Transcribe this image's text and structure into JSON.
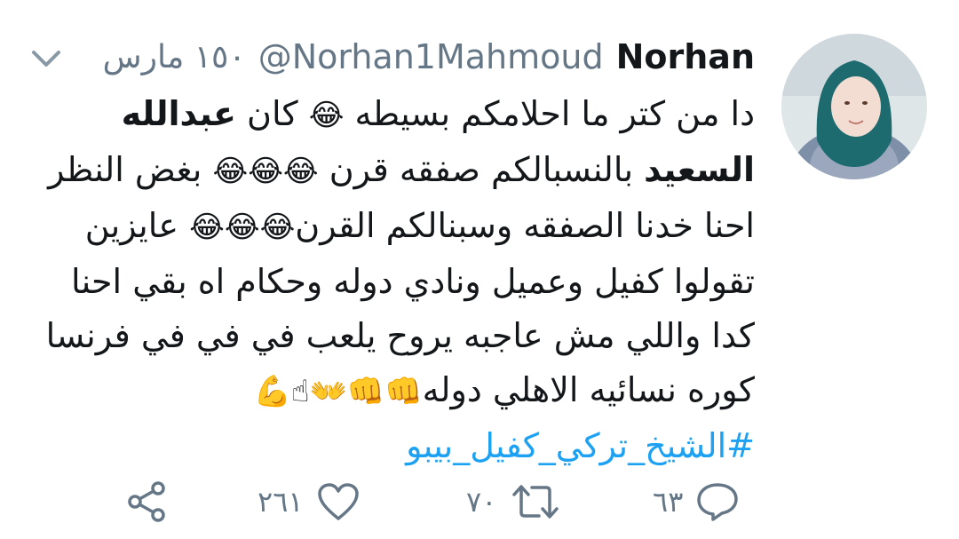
{
  "tweet": {
    "author_name": "Norhan",
    "author_handle": "@Norhan1Mahmoud",
    "date": "١٥٠ مارس",
    "lines": [
      {
        "before": "دا من كتر ما احلامكم بسيطه",
        "emoji": "😂",
        "after": "كان",
        "bold": "عبدالله"
      },
      {
        "bold": "السعيد",
        "before": "بالنسبالكم صفقه قرن",
        "emoji": "😂😂😂",
        "after": "بغض النظر"
      },
      {
        "before": "احنا خدنا الصفقه وسبنالكم القرن",
        "emoji": "😂😂😂",
        "after": "عايزين"
      },
      {
        "before": "تقولوا كفيل وعميل ونادي دوله وحكام اه بقي احنا"
      },
      {
        "before": "كدا واللي مش عاجبه يروح يلعب في في في فرنسا"
      },
      {
        "before": "كوره نسائيه الاهلي دوله",
        "emoji": "👊👊👐☝💪"
      }
    ],
    "hashtag": "#الشيخ_تركي_كفيل_بيبو"
  },
  "actions": {
    "reply_count": "٦٣",
    "retweet_count": "٧٠",
    "like_count": "٢٦١"
  },
  "colors": {
    "accent": "#1da1f2",
    "muted": "#657786",
    "text": "#14171a"
  },
  "icons": {
    "menu": "chevron-down-icon",
    "reply": "reply-icon",
    "retweet": "retweet-icon",
    "like": "heart-icon",
    "share": "share-icon"
  }
}
